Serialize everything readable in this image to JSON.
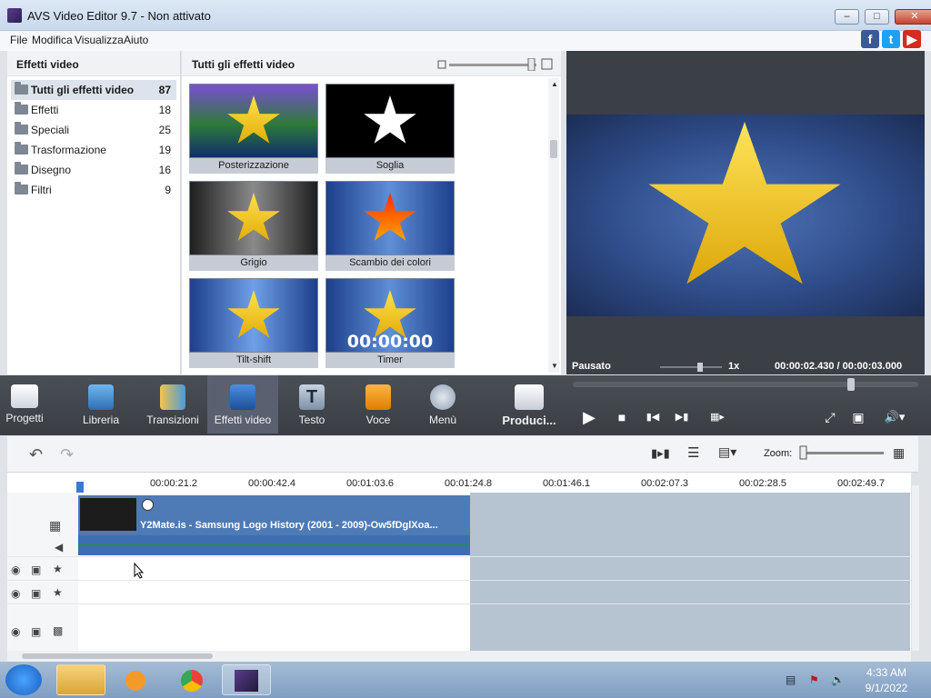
{
  "window": {
    "title": "AVS Video Editor 9.7 - Non attivato"
  },
  "menu": [
    "File",
    "Modifica",
    "Visualizza",
    "Aiuto"
  ],
  "categories": {
    "header": "Effetti video",
    "items": [
      {
        "label": "Tutti gli effetti video",
        "count": "87"
      },
      {
        "label": "Effetti",
        "count": "18"
      },
      {
        "label": "Speciali",
        "count": "25"
      },
      {
        "label": "Trasformazione",
        "count": "19"
      },
      {
        "label": "Disegno",
        "count": "16"
      },
      {
        "label": "Filtri",
        "count": "9"
      }
    ]
  },
  "effects": {
    "header": "Tutti gli effetti video",
    "tiles": [
      "Posterizzazione",
      "Soglia",
      "Grigio",
      "Scambio dei colori",
      "Tilt-shift",
      "Timer"
    ],
    "timer_overlay": "00:00:00"
  },
  "preview": {
    "status": "Pausato",
    "speed": "1x",
    "current_time": "00:00:02.430",
    "separator": "/",
    "total_time": "00:00:03.000"
  },
  "toolbar": {
    "items": [
      "Progetti",
      "Libreria",
      "Transizioni",
      "Effetti video",
      "Testo",
      "Voce",
      "Menù",
      "Produci..."
    ]
  },
  "timeline": {
    "zoom_label": "Zoom:",
    "ruler": [
      "00:00:21.2",
      "00:00:42.4",
      "00:01:03.6",
      "00:01:24.8",
      "00:01:46.1",
      "00:02:07.3",
      "00:02:28.5",
      "00:02:49.7"
    ],
    "clip_name": "Y2Mate.is - Samsung Logo History (2001 - 2009)-Ow5fDglXoa..."
  },
  "taskbar": {
    "time": "4:33 AM",
    "date": "9/1/2022"
  },
  "colors": {
    "accent": "#4e7ab5",
    "toolbar": "#3a3e44"
  }
}
